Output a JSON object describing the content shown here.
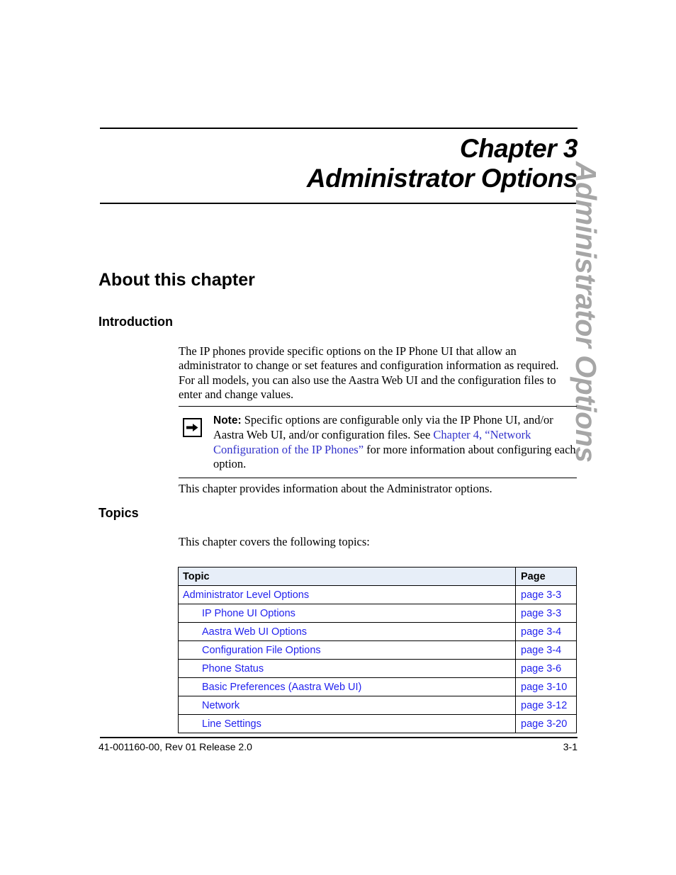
{
  "chapter": {
    "number": "Chapter 3",
    "name": "Administrator Options",
    "side_tab": "Administrator Options"
  },
  "sections": {
    "about_heading": "About this chapter",
    "introduction_heading": "Introduction",
    "topics_heading": "Topics"
  },
  "paragraphs": {
    "intro": "The IP phones provide specific options on the IP Phone UI that allow an administrator to change or set features and configuration information as required. For all models, you can also use the Aastra Web UI and the configuration files to enter and change values.",
    "chapter_info": "This chapter provides information about the Administrator options.",
    "covers": "This chapter covers the following topics:"
  },
  "note": {
    "icon": "right-arrow-icon",
    "label": "Note:",
    "text_before_link": " Specific options are configurable only via the IP Phone UI, and/or Aastra Web UI, and/or configuration files. See ",
    "link_text": "Chapter 4, “Network Configuration of the IP Phones”",
    "text_after_link": " for more information about configuring each option."
  },
  "topics_table": {
    "headers": [
      "Topic",
      "Page"
    ],
    "rows": [
      {
        "topic": "Administrator Level Options",
        "page": "page 3-3",
        "indent": 0
      },
      {
        "topic": "IP Phone UI Options",
        "page": "page 3-3",
        "indent": 1
      },
      {
        "topic": "Aastra Web UI Options",
        "page": "page 3-4",
        "indent": 1
      },
      {
        "topic": "Configuration File Options",
        "page": "page 3-4",
        "indent": 1
      },
      {
        "topic": "Phone Status",
        "page": "page 3-6",
        "indent": 1
      },
      {
        "topic": "Basic Preferences (Aastra Web UI)",
        "page": "page 3-10",
        "indent": 1
      },
      {
        "topic": "Network",
        "page": "page 3-12",
        "indent": 1
      },
      {
        "topic": "Line Settings",
        "page": "page 3-20",
        "indent": 1
      }
    ]
  },
  "footer": {
    "left": "41-001160-00, Rev 01  Release 2.0",
    "right": "3-1"
  },
  "colors": {
    "link_blue": "#3333cc",
    "table_link_blue": "#2222ee",
    "table_header_bg": "#e7eef8",
    "side_tab_gray": "#a6a6a6"
  }
}
